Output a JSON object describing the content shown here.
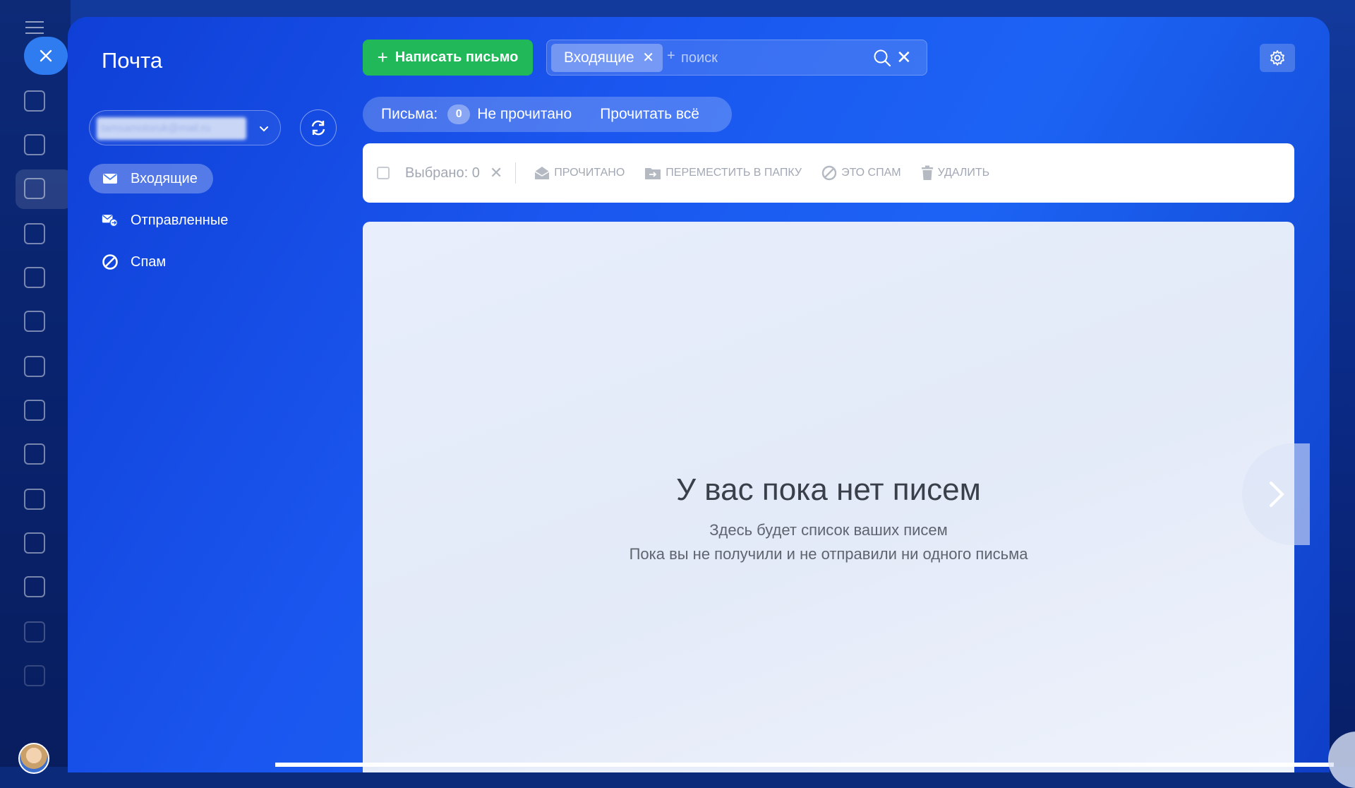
{
  "app": {
    "sidebar_icons": [
      "menu-icon",
      "crm-icon",
      "tasks-icon",
      "filter-icon",
      "calendar-icon",
      "building-icon",
      "target-icon",
      "cart-icon",
      "doc-edit-icon",
      "pen-icon",
      "chart-icon",
      "card-icon",
      "robot-icon",
      "gear-icon",
      "stats-icon"
    ]
  },
  "slider": {
    "title": "Почта",
    "mailbox_email": "tamsamotoruk@mail.ru",
    "folders": [
      {
        "label": "Входящие",
        "icon": "envelope-icon",
        "active": true
      },
      {
        "label": "Отправленные",
        "icon": "sent-icon",
        "active": false
      },
      {
        "label": "Спам",
        "icon": "block-icon",
        "active": false
      }
    ]
  },
  "toolbar": {
    "compose_label": "Написать письмо",
    "filter_tag": "Входящие",
    "search_placeholder": "поиск",
    "settings_icon": "gear-icon"
  },
  "counters": {
    "label": "Письма:",
    "unread_count": "0",
    "unread_label": "Не прочитано",
    "read_all_label": "Прочитать всё"
  },
  "actions": {
    "selected_label": "Выбрано: 0",
    "read": "ПРОЧИТАНО",
    "move": "ПЕРЕМЕСТИТЬ В ПАПКУ",
    "spam": "ЭТО СПАМ",
    "delete": "УДАЛИТЬ"
  },
  "empty": {
    "title": "У вас пока нет писем",
    "line1": "Здесь будет список ваших писем",
    "line2": "Пока вы не получили и не отправили ни одного письма"
  },
  "colors": {
    "compose": "#21b85a",
    "panel": "#1a56ef"
  }
}
